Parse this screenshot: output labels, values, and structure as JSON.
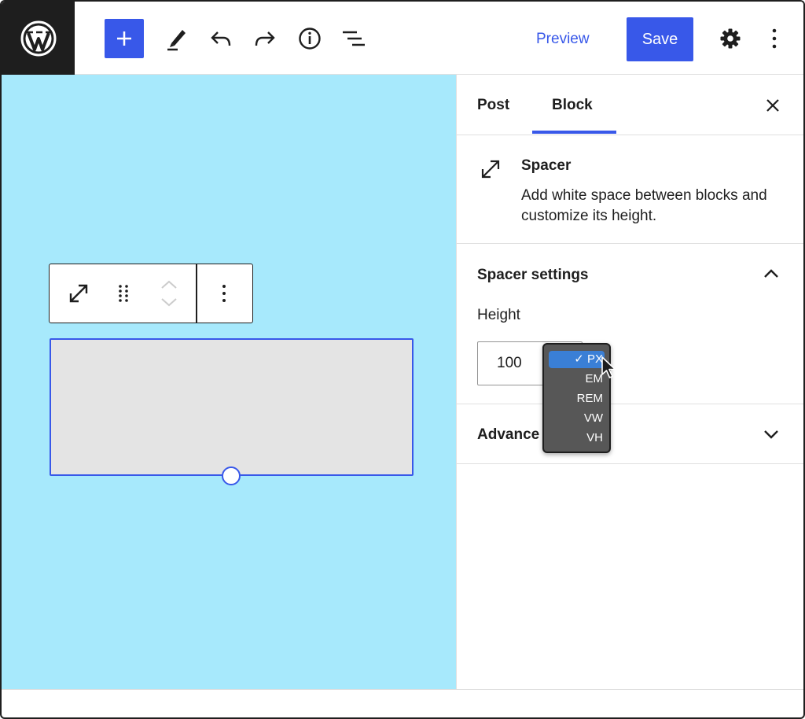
{
  "header": {
    "preview_label": "Preview",
    "save_label": "Save",
    "accent_color": "#3858e9"
  },
  "icons": {
    "logo": "wordpress-logo-icon",
    "add": "plus-icon",
    "tools": "pencil-icon",
    "undo": "undo-icon",
    "redo": "redo-icon",
    "details": "info-icon",
    "outline": "list-view-icon",
    "settings": "gear-icon",
    "options": "more-vertical-icon"
  },
  "sidebar": {
    "tabs": [
      {
        "label": "Post",
        "active": false
      },
      {
        "label": "Block",
        "active": true
      }
    ],
    "block": {
      "title": "Spacer",
      "description": "Add white space between blocks and customize its height."
    },
    "spacer_settings": {
      "title": "Spacer settings",
      "expanded": true,
      "height_label": "Height",
      "height_value": "100"
    },
    "advanced": {
      "title": "Advance",
      "expanded": false
    }
  },
  "unit_menu": {
    "options": [
      {
        "label": "PX",
        "selected": true
      },
      {
        "label": "EM",
        "selected": false
      },
      {
        "label": "REM",
        "selected": false
      },
      {
        "label": "VW",
        "selected": false
      },
      {
        "label": "VH",
        "selected": false
      }
    ],
    "check_mark": "✓"
  },
  "canvas": {
    "background_color": "#a7e9fc",
    "spacer_color": "#e4e4e4"
  }
}
